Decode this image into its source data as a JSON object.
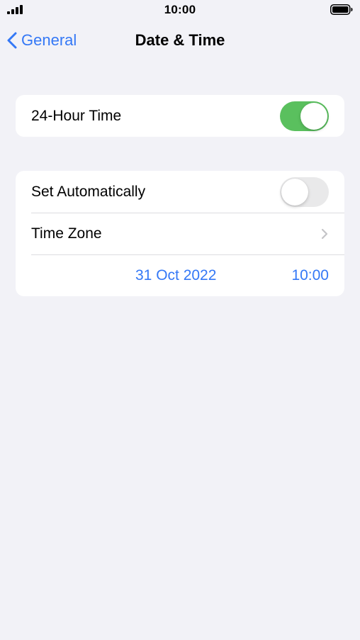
{
  "status_bar": {
    "time": "10:00",
    "signal_icon": "cellular-signal-icon",
    "battery_icon": "battery-icon"
  },
  "nav": {
    "back_label": "General",
    "title": "Date & Time",
    "accent_color": "#3478f6"
  },
  "group1": {
    "hour_24": {
      "label": "24-Hour Time",
      "enabled": true
    }
  },
  "group2": {
    "set_automatically": {
      "label": "Set Automatically",
      "enabled": false
    },
    "time_zone": {
      "label": "Time Zone"
    },
    "date": "31 Oct 2022",
    "time": "10:00"
  },
  "colors": {
    "toggle_on": "#5ac05e",
    "toggle_off": "#e9e9ea",
    "background": "#f2f2f7"
  }
}
